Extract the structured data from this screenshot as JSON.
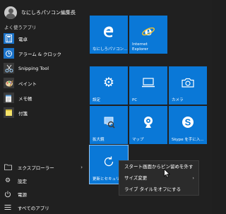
{
  "user": {
    "name": "なにしろパソコン編集長"
  },
  "sections": {
    "most_used": "よく使うアプリ"
  },
  "apps": [
    {
      "label": "電卓",
      "icon": "calculator-icon",
      "color": "#1a72c8"
    },
    {
      "label": "アラーム & クロック",
      "icon": "alarm-clock-icon",
      "color": "#1a72c8"
    },
    {
      "label": "Snipping Tool",
      "icon": "scissors-icon",
      "color": "#2a2a2a"
    },
    {
      "label": "ペイント",
      "icon": "paint-palette-icon",
      "color": "#2a2a2a"
    },
    {
      "label": "メモ帳",
      "icon": "notepad-icon",
      "color": "#2a2a2a"
    },
    {
      "label": "付箋",
      "icon": "sticky-note-icon",
      "color": "#2a2a2a"
    }
  ],
  "bottom": {
    "explorer": "エクスプローラー",
    "settings": "設定",
    "power": "電源",
    "all_apps": "すべてのアプリ"
  },
  "tiles": {
    "nashiro": "なにしろパソコン...",
    "ie_line1": "Internet",
    "ie_line2": "Explorer",
    "settings": "設定",
    "pc": "PC",
    "camera": "カメラ",
    "magnifier": "拡大鏡",
    "maps": "マップ",
    "skype": "Skype を手に入...",
    "update": "更新とセキュリティ"
  },
  "context_menu": {
    "unpin": "スタート画面からピン留めを外す",
    "resize": "サイズ変更",
    "live_tile_off": "ライブ タイルをオフにする"
  },
  "colors": {
    "tile_blue": "#0a78d7",
    "background": "#202020"
  }
}
